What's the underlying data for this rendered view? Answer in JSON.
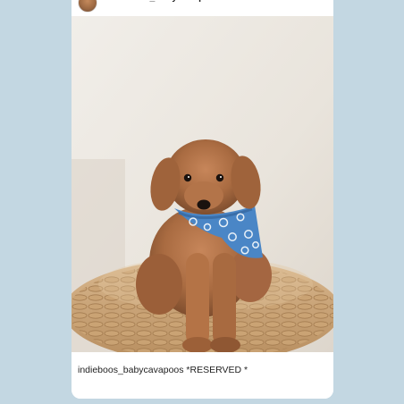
{
  "post": {
    "username": "indieboos_babycavapoos",
    "caption": "indieboos_babycavapoos *RESERVED *",
    "image_alt_icon": "puppy-photo"
  },
  "colors": {
    "background": "#c3d7e2",
    "card": "#ffffff",
    "text": "#222222",
    "bandana": "#4a86c6"
  }
}
